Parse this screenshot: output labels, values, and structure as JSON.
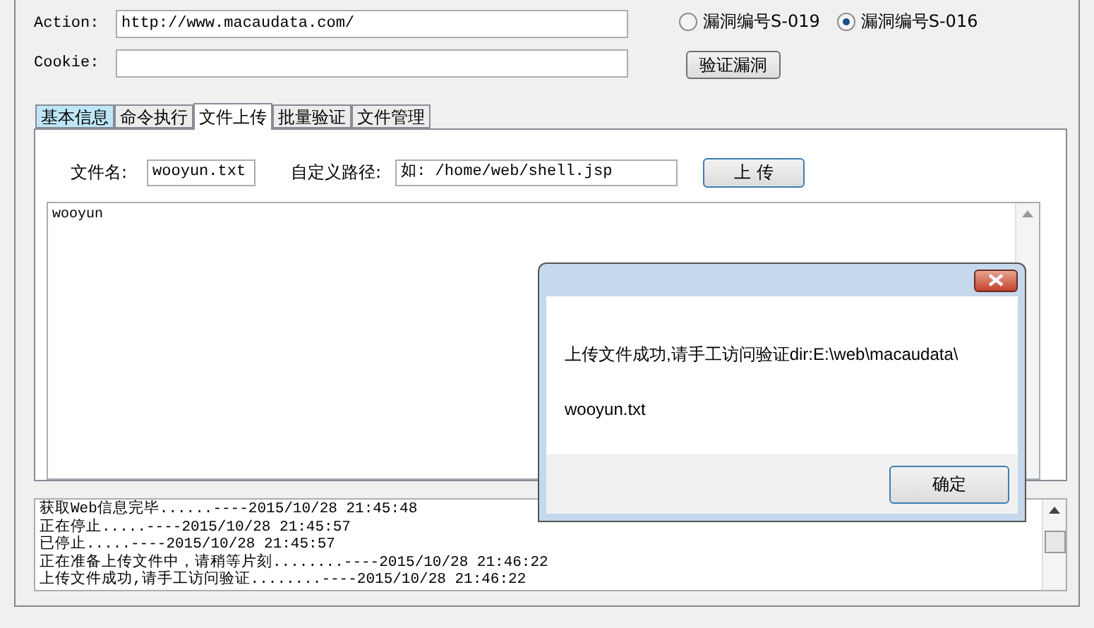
{
  "form": {
    "fields": [
      {
        "label": "Action:",
        "value": "http://www.macaudata.com/"
      },
      {
        "label": "Cookie:"
      }
    ],
    "radios": [
      {
        "label": "漏洞编号S-019",
        "selected": false
      },
      {
        "label": "漏洞编号S-016",
        "selected": true
      }
    ],
    "verify_button": "验证漏洞"
  },
  "tabs": [
    {
      "label": "基本信息",
      "selected": false,
      "highlighted": true
    },
    {
      "label": "命令执行",
      "selected": false,
      "highlighted": false
    },
    {
      "label": "文件上传",
      "selected": true,
      "highlighted": false
    },
    {
      "label": "批量验证",
      "selected": false,
      "highlighted": false
    },
    {
      "label": "文件管理",
      "selected": false,
      "highlighted": false
    }
  ],
  "upload": {
    "filename_label": "文件名:",
    "filename": "wooyun.txt",
    "path_label": "自定义路径:",
    "path": "如: /home/web/shell.jsp",
    "button": "上 传",
    "content": "wooyun"
  },
  "log": [
    "获取Web信息完毕......----2015/10/28 21:45:48",
    "正在停止.....----2015/10/28 21:45:57",
    "已停止.....----2015/10/28 21:45:57",
    "正在准备上传文件中，请稍等片刻........----2015/10/28 21:46:22",
    "上传文件成功,请手工访问验证........----2015/10/28 21:46:22"
  ],
  "dialog": {
    "lines": [
      "上传文件成功,请手工访问验证dir:E:\\web\\macaudata\\",
      "wooyun.txt"
    ],
    "ok_button": "确定"
  }
}
